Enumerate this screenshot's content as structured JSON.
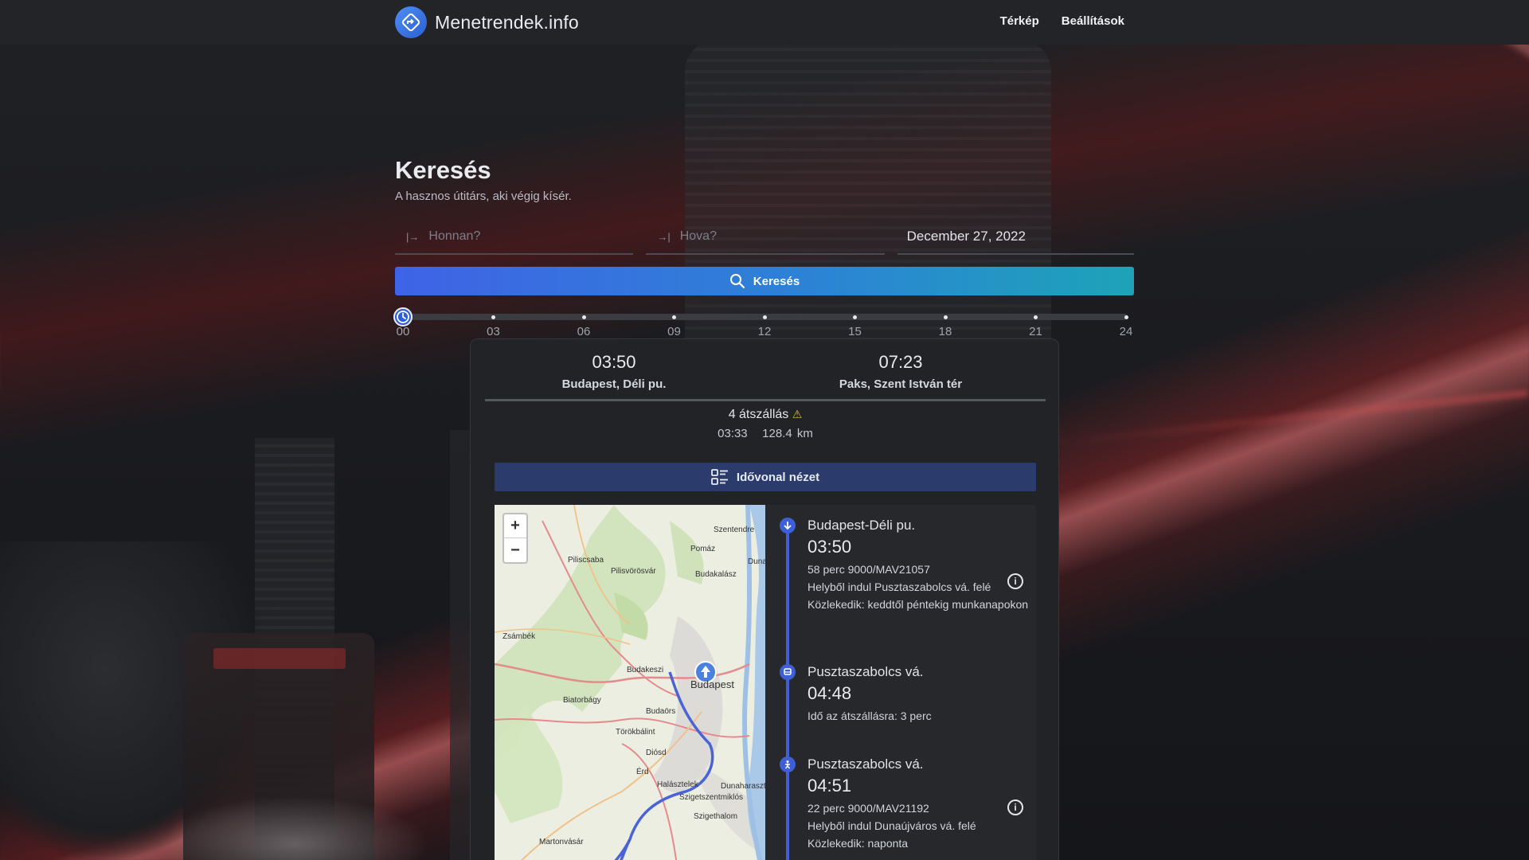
{
  "header": {
    "brand": "Menetrendek.info",
    "nav": [
      "Térkép",
      "Beállítások"
    ]
  },
  "search": {
    "title": "Keresés",
    "subtitle": "A hasznos útitárs, aki végig kísér.",
    "from_placeholder": "Honnan?",
    "to_placeholder": "Hova?",
    "date": "December 27, 2022",
    "button": "Keresés"
  },
  "timeline": {
    "labels": [
      "00",
      "03",
      "06",
      "09",
      "12",
      "15",
      "18",
      "21",
      "24"
    ],
    "selected_hour": 0
  },
  "route": {
    "departure": {
      "time": "03:50",
      "place": "Budapest, Déli pu."
    },
    "arrival": {
      "time": "07:23",
      "place": "Paks, Szent István tér"
    },
    "transfers": "4 átszállás",
    "duration": "03:33",
    "distance": "128.4 km",
    "timeline_view_button": "Idővonal nézet"
  },
  "map": {
    "labels": [
      "Szentendre",
      "Piliscsaba",
      "Pilisvörösvár",
      "Pomáz",
      "Budakalász",
      "Duna",
      "Zsámbék",
      "Budakeszi",
      "Budapest",
      "Biatorbágy",
      "Budaörs",
      "Törökbálint",
      "Diósd",
      "Érd",
      "Halásztelek",
      "Dunaharaszti",
      "Szigetszentmiklós",
      "Szigethalom",
      "Martonvásár"
    ],
    "zoom_in": "+",
    "zoom_out": "−"
  },
  "stops": [
    {
      "name": "Budapest-Déli pu.",
      "time": "03:50",
      "details": [
        "58 perc   9000/MAV21057",
        "Helyből indul Pusztaszabolcs vá. felé",
        "Közlekedik: keddtől péntekig munkanapokon"
      ],
      "icon": "departure-arrow-icon"
    },
    {
      "name": "Pusztaszabolcs vá.",
      "time": "04:48",
      "details": [
        "Idő az átszállásra: 3 perc"
      ],
      "icon": "train-icon"
    },
    {
      "name": "Pusztaszabolcs vá.",
      "time": "04:51",
      "details": [
        "22 perc   9000/MAV21192",
        "Helyből indul Dunaújváros vá. felé",
        "Közlekedik: naponta"
      ],
      "icon": "walking-icon"
    }
  ],
  "colors": {
    "accent": "#3f63e6",
    "route_line": "#3f5fd8",
    "warning": "#e6b73a"
  }
}
